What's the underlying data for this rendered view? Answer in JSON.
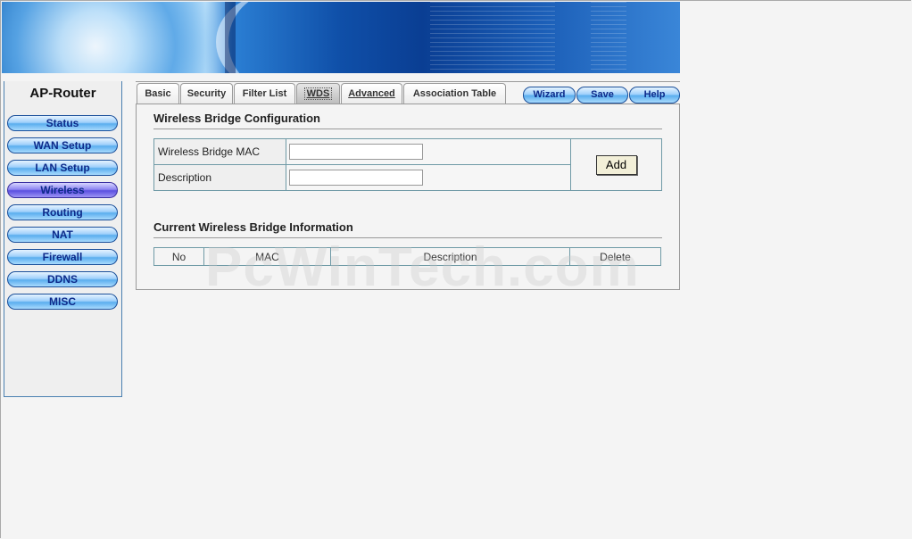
{
  "brand": "AP-Router",
  "sidebar": {
    "items": [
      {
        "label": "Status"
      },
      {
        "label": "WAN Setup"
      },
      {
        "label": "LAN Setup"
      },
      {
        "label": "Wireless",
        "active": true
      },
      {
        "label": "Routing"
      },
      {
        "label": "NAT"
      },
      {
        "label": "Firewall"
      },
      {
        "label": "DDNS"
      },
      {
        "label": "MISC"
      }
    ]
  },
  "tabs": [
    {
      "label": "Basic"
    },
    {
      "label": "Security"
    },
    {
      "label": "Filter List"
    },
    {
      "label": "WDS",
      "active": true
    },
    {
      "label": "Advanced"
    },
    {
      "label": "Association Table"
    }
  ],
  "actions": {
    "wizard": "Wizard",
    "save": "Save",
    "help": "Help"
  },
  "config": {
    "title": "Wireless Bridge Configuration",
    "mac_label": "Wireless Bridge MAC",
    "mac_value": "",
    "desc_label": "Description",
    "desc_value": "",
    "add_label": "Add"
  },
  "info": {
    "title": "Current Wireless Bridge Information",
    "columns": [
      "No",
      "MAC",
      "Description",
      "Delete"
    ]
  },
  "watermark": "PcWinTech.com"
}
